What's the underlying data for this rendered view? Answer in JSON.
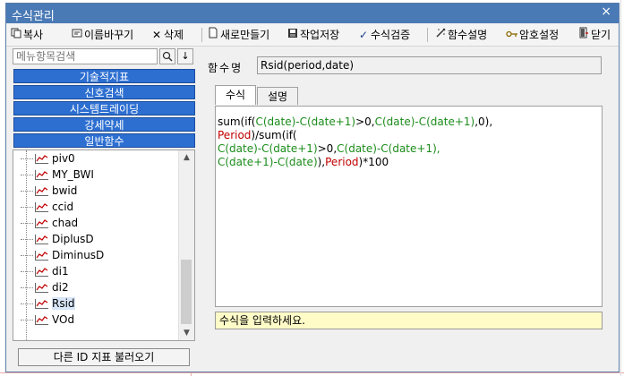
{
  "window": {
    "title": "수식관리",
    "close_icon": "×"
  },
  "toolbar": {
    "copy": "복사",
    "rename": "이름바꾸기",
    "delete": "삭제",
    "new": "새로만들기",
    "save": "작업저장",
    "verify": "수식검증",
    "function_help": "함수설명",
    "password": "암호설정",
    "close": "닫기"
  },
  "sidebar": {
    "search_placeholder": "메뉴항목검색",
    "categories": [
      "기술적지표",
      "신호검색",
      "시스템트레이딩",
      "강세약세",
      "일반함수"
    ],
    "items": [
      "piv0",
      "MY_BWI",
      "bwid",
      "ccid",
      "chad",
      "DiplusD",
      "DiminusD",
      "di1",
      "di2",
      "Rsid",
      "VOd"
    ],
    "selected": "Rsid",
    "load_button": "다른 ID 지표 불러오기"
  },
  "main": {
    "name_label": "함수명",
    "name_value": "Rsid(period,date)",
    "tabs": [
      "수식",
      "설명"
    ],
    "active_tab": "수식",
    "formula_lines": [
      [
        {
          "t": "sum(if(",
          "c": "black"
        },
        {
          "t": "C(date)-C(date+1)",
          "c": "green"
        },
        {
          "t": ">0,",
          "c": "black"
        },
        {
          "t": "C(date)-C(date+1)",
          "c": "green"
        },
        {
          "t": ",0),",
          "c": "black"
        }
      ],
      [
        {
          "t": "Period",
          "c": "red"
        },
        {
          "t": ")/sum(if(",
          "c": "black"
        }
      ],
      [
        {
          "t": "C(date)-C(date+1)",
          "c": "green"
        },
        {
          "t": ">0,",
          "c": "black"
        },
        {
          "t": "C(date)-C(date+1),",
          "c": "green"
        }
      ],
      [
        {
          "t": "C(date+1)-C(date)",
          "c": "green"
        },
        {
          "t": "),",
          "c": "black"
        },
        {
          "t": "Period",
          "c": "red"
        },
        {
          "t": ")*100",
          "c": "black"
        }
      ]
    ],
    "status_text": "수식을 입력하세요."
  },
  "colors": {
    "title_bar": "#4a7ab5",
    "category_bg": "#2d6fd1",
    "formula_green": "#1b8c1b",
    "formula_red": "#c00000",
    "status_bg": "#fffcc8"
  }
}
